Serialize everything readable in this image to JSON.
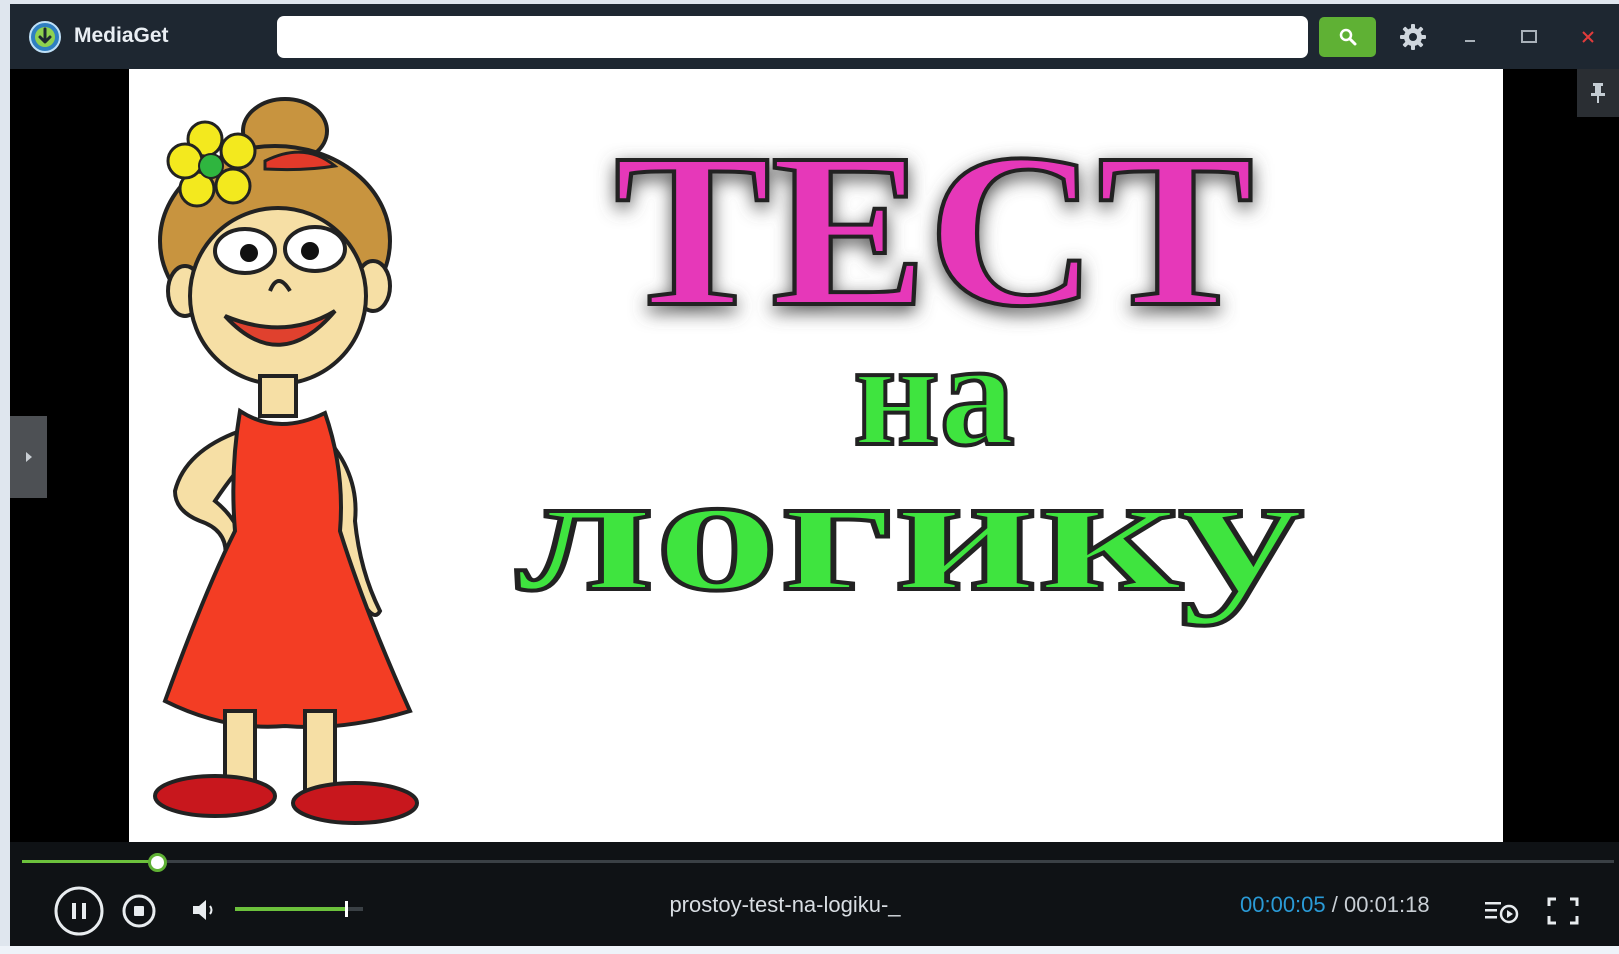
{
  "app": {
    "title": "MediaGet",
    "logo_icon": "mediaget-download-icon",
    "accent_color": "#5fb134"
  },
  "search": {
    "value": "",
    "placeholder": ""
  },
  "toolbar": {
    "search_icon": "search-icon",
    "settings_icon": "gear-icon"
  },
  "window_controls": {
    "minimize_icon": "minimize-icon",
    "maximize_icon": "maximize-icon",
    "close_icon": "close-icon",
    "close_color": "#e23b3b"
  },
  "video": {
    "line1": "ТЕСТ",
    "line2": "на",
    "line3": "логику",
    "line1_color": "#e637b9",
    "line2_3_color": "#3fe43f",
    "pin_icon": "pin-icon",
    "side_panel_icon": "chevron-right-icon",
    "illustration": "cartoon-girl-red-dress"
  },
  "player": {
    "filename": "prostoy-test-na-logiku-_",
    "current_time": "00:00:05",
    "separator": " / ",
    "total_time": "00:01:18",
    "progress": 0.064,
    "volume": 0.85,
    "icons": {
      "pause": "pause-icon",
      "stop": "stop-icon",
      "volume": "speaker-icon",
      "playlist": "playlist-icon",
      "fullscreen": "fullscreen-icon"
    }
  }
}
